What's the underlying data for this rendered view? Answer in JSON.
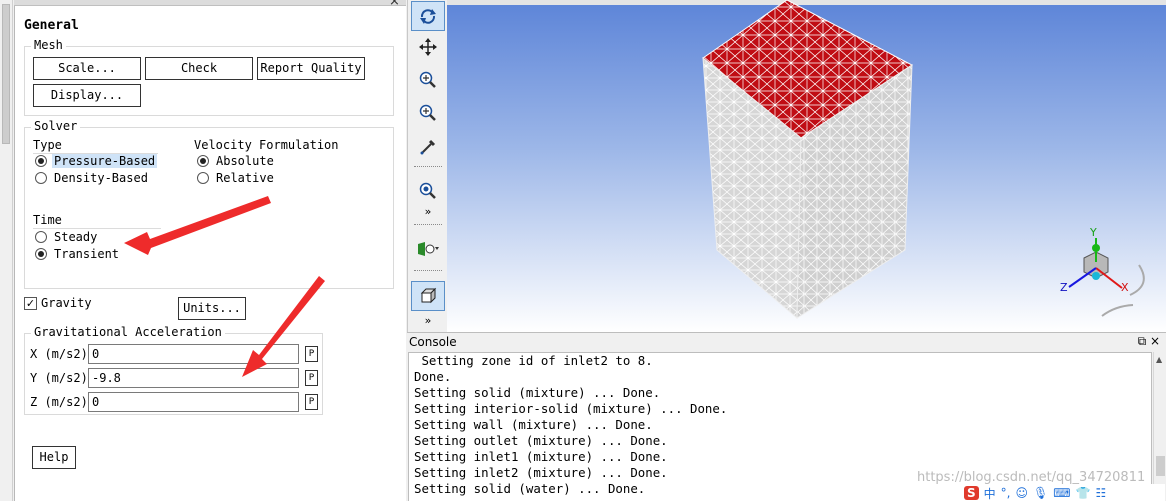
{
  "panel": {
    "title": "General",
    "close": "×"
  },
  "mesh": {
    "label": "Mesh",
    "scale": "Scale...",
    "check": "Check",
    "report_quality": "Report Quality",
    "display": "Display..."
  },
  "solver": {
    "label": "Solver",
    "type_label": "Type",
    "type_options": [
      "Pressure-Based",
      "Density-Based"
    ],
    "type_selected": "Pressure-Based",
    "velocity_label": "Velocity Formulation",
    "velocity_options": [
      "Absolute",
      "Relative"
    ],
    "velocity_selected": "Absolute",
    "time_label": "Time",
    "time_options": [
      "Steady",
      "Transient"
    ],
    "time_selected": "Transient"
  },
  "gravity": {
    "label": "Gravity",
    "checked": true,
    "check_glyph": "✓",
    "units": "Units...",
    "accel_label": "Gravitational Acceleration",
    "rows": [
      {
        "label": "X (m/s2)",
        "value": "0",
        "param": "P"
      },
      {
        "label": "Y (m/s2)",
        "value": "-9.8",
        "param": "P"
      },
      {
        "label": "Z (m/s2)",
        "value": "0",
        "param": "P"
      }
    ]
  },
  "help": "Help",
  "toolbar": {
    "items": [
      "rotate-icon",
      "pan-icon",
      "zoom-in-out-icon",
      "zoom-to-area-icon",
      "probe-icon",
      "fit-to-window-icon",
      "more-chevron-icon",
      "lighting-icon",
      "view-cube-icon",
      "more-chevron-icon"
    ]
  },
  "viewport": {
    "top_face_color": "#c00d14",
    "side_face_color": "#d9d9d9",
    "triad": {
      "x": "X",
      "y": "Y",
      "z": "Z"
    }
  },
  "console": {
    "title": "Console",
    "controls": "⧉ ×",
    "lines": [
      " Setting zone id of inlet2 to 8.",
      "Done.",
      "Setting solid (mixture) ... Done.",
      "Setting interior-solid (mixture) ... Done.",
      "Setting wall (mixture) ... Done.",
      "Setting outlet (mixture) ... Done.",
      "Setting inlet1 (mixture) ... Done.",
      "Setting inlet2 (mixture) ... Done.",
      "Setting solid (water) ... Done."
    ],
    "watermark": "https://blog.csdn.net/qq_34720811",
    "ime": [
      "S",
      "中",
      "°,",
      "☺",
      "🎙",
      "⌨",
      "👕",
      "☷"
    ]
  }
}
